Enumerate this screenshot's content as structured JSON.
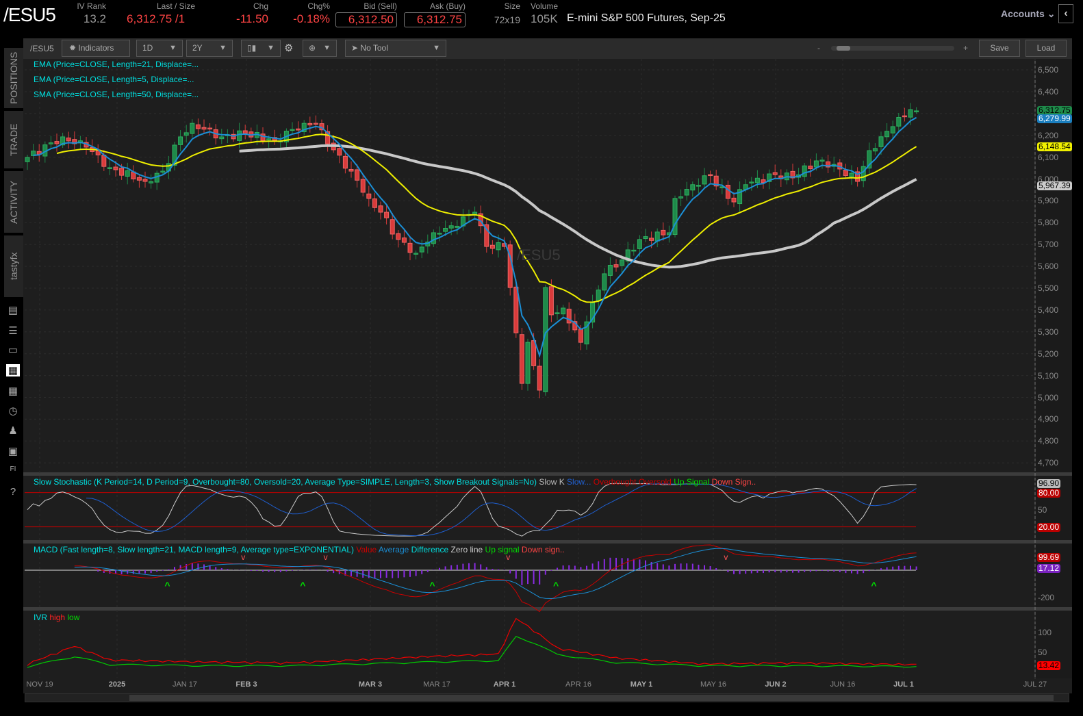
{
  "header": {
    "symbol": "/ESU5",
    "iv_rank_label": "IV Rank",
    "iv_rank": "13.2",
    "last_label": "Last / Size",
    "last": "6,312.75",
    "last_size": "/1",
    "chg_label": "Chg",
    "chg": "-11.50",
    "chgp_label": "Chg%",
    "chgp": "-0.18%",
    "bid_label": "Bid (Sell)",
    "bid": "6,312.50",
    "ask_label": "Ask (Buy)",
    "ask": "6,312.75",
    "size_label": "Size",
    "size": "72x19",
    "volume_label": "Volume",
    "volume": "105K",
    "description": "E-mini S&P 500 Futures, Sep-25",
    "accounts": "Accounts"
  },
  "sidebar": {
    "tabs": [
      "POSITIONS",
      "TRADE",
      "ACTIVITY",
      "tastyfx"
    ]
  },
  "toolbar": {
    "symbol": "/ESU5",
    "indicators": "Indicators",
    "interval": "1D",
    "range": "2Y",
    "tool": "No Tool",
    "zoom_minus": "-",
    "zoom_plus": "+",
    "save": "Save",
    "load": "Load",
    "zoom_level": 0.05
  },
  "studies": {
    "ema21": "EMA (Price=CLOSE, Length=21, Displace=...",
    "ema5": "EMA (Price=CLOSE, Length=5, Displace=...",
    "sma50": "SMA (Price=CLOSE, Length=50, Displace=...",
    "watermark": "/ESU5",
    "stoch": {
      "title": "Slow Stochastic (K Period=14, D Period=9, Overbought=80, Oversold=20, Average Type=SIMPLE, Length=3, Show Breakout Signals=No)",
      "k": "Slow K",
      "d": "Slow...",
      "ob": "Overbought",
      "os": "Oversold",
      "up": "Up Signal",
      "down": "Down Sign.."
    },
    "macd": {
      "title": "MACD (Fast length=8, Slow length=21, MACD length=9, Average type=EXPONENTIAL)",
      "value": "Value",
      "avg": "Average",
      "diff": "Difference",
      "zero": "Zero line",
      "up": "Up signal",
      "down": "Down sign.."
    },
    "ivr": {
      "title": "IVR",
      "high": "high",
      "low": "low"
    }
  },
  "badges": {
    "last": "6,312.75",
    "ema5": "6,279.99",
    "ema21": "6,148.54",
    "sma50": "5,967.39",
    "stoch_k": "96.90",
    "stoch_ob": "80.00",
    "stoch_os": "20.00",
    "macd_value": "99.69",
    "macd_diff": "17.12",
    "ivr_high": "13.42",
    "axis_50": "50",
    "axis_m200": "-200",
    "axis_100": "100",
    "axis_50b": "50"
  },
  "chart_data": {
    "type": "candlestick",
    "title": "/ESU5 1D",
    "ylim": [
      4650,
      6560
    ],
    "y_ticks": [
      "6,500",
      "6,400",
      "6,300",
      "6,200",
      "6,100",
      "6,000",
      "5,900",
      "5,800",
      "5,700",
      "5,600",
      "5,500",
      "5,400",
      "5,300",
      "5,200",
      "5,100",
      "5,000",
      "4,900",
      "4,800",
      "4,700"
    ],
    "x_ticks": [
      "NOV 19",
      "2025",
      "JAN 17",
      "FEB 3",
      "MAR 3",
      "MAR 17",
      "APR 1",
      "APR 16",
      "MAY 1",
      "MAY 16",
      "JUN 2",
      "JUN 16",
      "JUL 1",
      "JUL 27"
    ],
    "close_keypoints": [
      [
        0,
        6099
      ],
      [
        6,
        6193
      ],
      [
        10,
        6146
      ],
      [
        14,
        6052
      ],
      [
        20,
        5989
      ],
      [
        23,
        6036
      ],
      [
        26,
        6193
      ],
      [
        28,
        6255
      ],
      [
        33,
        6193
      ],
      [
        37,
        6208
      ],
      [
        42,
        6177
      ],
      [
        47,
        6255
      ],
      [
        49,
        6255
      ],
      [
        51,
        6161
      ],
      [
        55,
        6036
      ],
      [
        58,
        5911
      ],
      [
        60,
        5848
      ],
      [
        63,
        5723
      ],
      [
        66,
        5660
      ],
      [
        69,
        5754
      ],
      [
        72,
        5786
      ],
      [
        76,
        5848
      ],
      [
        78,
        5691
      ],
      [
        81,
        5691
      ],
      [
        82,
        5503
      ],
      [
        84,
        5064
      ],
      [
        85,
        5252
      ],
      [
        87,
        5033
      ],
      [
        88,
        5503
      ],
      [
        89,
        5378
      ],
      [
        91,
        5409
      ],
      [
        94,
        5252
      ],
      [
        95,
        5346
      ],
      [
        98,
        5566
      ],
      [
        101,
        5629
      ],
      [
        104,
        5723
      ],
      [
        109,
        5754
      ],
      [
        110,
        5911
      ],
      [
        113,
        5974
      ],
      [
        116,
        6020
      ],
      [
        119,
        5911
      ],
      [
        120,
        5895
      ],
      [
        122,
        5974
      ],
      [
        127,
        6020
      ],
      [
        130,
        6005
      ],
      [
        134,
        6083
      ],
      [
        137,
        6067
      ],
      [
        141,
        5989
      ],
      [
        143,
        6130
      ],
      [
        147,
        6240
      ],
      [
        150,
        6318
      ],
      [
        151,
        6312
      ]
    ],
    "ivr_keypoints": [
      [
        0,
        15,
        10
      ],
      [
        8,
        60,
        35
      ],
      [
        14,
        25,
        15
      ],
      [
        30,
        20,
        12
      ],
      [
        45,
        18,
        12
      ],
      [
        60,
        28,
        18
      ],
      [
        70,
        35,
        22
      ],
      [
        80,
        40,
        25
      ],
      [
        83,
        130,
        85
      ],
      [
        86,
        100,
        70
      ],
      [
        90,
        55,
        40
      ],
      [
        100,
        30,
        20
      ],
      [
        115,
        15,
        12
      ],
      [
        130,
        18,
        12
      ],
      [
        151,
        13.42,
        10
      ]
    ],
    "colors": {
      "up": "#1e8a4a",
      "down": "#d93b3b",
      "ema5": "#1b8fd6",
      "ema21": "#f0f000",
      "sma50": "#c8c8c8"
    }
  }
}
